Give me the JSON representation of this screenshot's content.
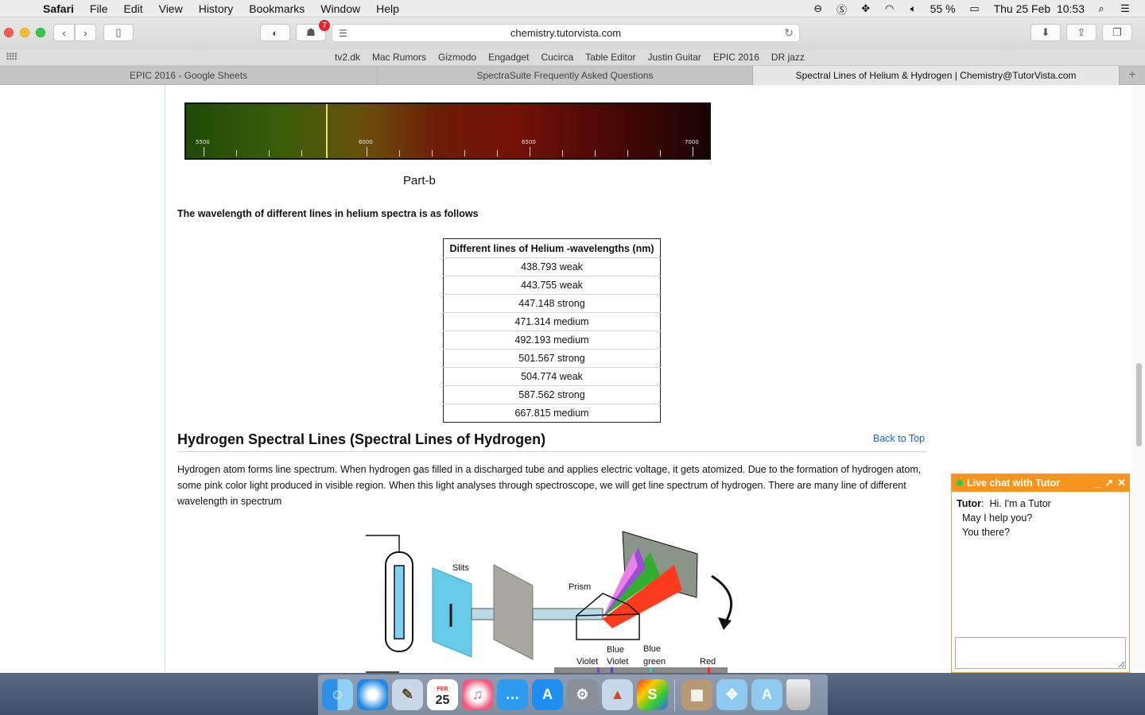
{
  "menubar": {
    "app": "Safari",
    "items": [
      "File",
      "Edit",
      "View",
      "History",
      "Bookmarks",
      "Window",
      "Help"
    ],
    "battery": "55 %",
    "datetime": "Thu 25 Feb  10:53"
  },
  "toolbar": {
    "url": "chemistry.tutorvista.com",
    "badge_count": "7"
  },
  "favorites": [
    "tv2.dk",
    "Mac Rumors",
    "Gizmodo",
    "Engadget",
    "Cucirca",
    "Table Editor",
    "Justin Guitar",
    "EPIC 2016",
    "DR jazz"
  ],
  "tabs": [
    {
      "label": "EPIC 2016 - Google Sheets"
    },
    {
      "label": "SpectraSuite Frequently Asked Questions"
    },
    {
      "label": "Spectral Lines of Helium & Hydrogen | Chemistry@TutorVista.com"
    }
  ],
  "page": {
    "spectrum_ticks": [
      "5500",
      "6000",
      "6500",
      "7000"
    ],
    "part_b_caption": "Part-b",
    "intro_text": "The wavelength of different lines in helium spectra is as follows",
    "table_header": "Different lines of Helium -wavelengths (nm)",
    "table_rows": [
      "438.793 weak",
      "443.755 weak",
      "447.148 strong",
      "471.314 medium",
      "492.193 medium",
      "501.567 strong",
      "504.774 weak",
      "587.562 strong",
      "667.815 medium"
    ],
    "heading": "Hydrogen Spectral Lines (Spectral Lines of Hydrogen)",
    "back_to_top": "Back to Top",
    "paragraph": "Hydrogen atom forms line spectrum. When hydrogen gas filled in a discharged tube and applies electric voltage, it gets atomized. Due to the formation of hydrogen atom, some pink color light produced in visible region. When this light analyses through spectroscope, we will get line spectrum of hydrogen. There are many line of different wavelength in spectrum",
    "diagram_labels": {
      "slits": "Slits",
      "prism": "Prism",
      "violet": "Violet",
      "blue_violet_1": "Blue",
      "blue_violet_2": "Violet",
      "blue_green_1": "Blue",
      "blue_green_2": "green",
      "red": "Red"
    }
  },
  "chat": {
    "title": "Live chat with Tutor",
    "speaker": "Tutor",
    "line1": "Hi. I'm a Tutor",
    "line2": "May I help you?",
    "line3": "You there?"
  },
  "dock": {
    "calendar_month": "FEB",
    "calendar_day": "25"
  }
}
